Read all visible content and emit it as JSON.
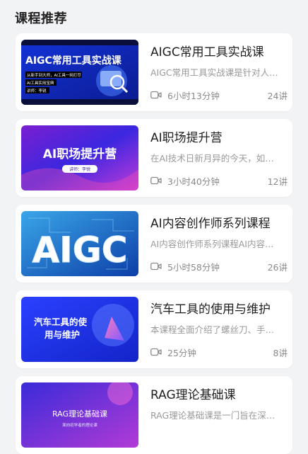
{
  "section": {
    "title": "课程推荐"
  },
  "courses": [
    {
      "title": "AIGC常用工具实战课",
      "description": "AIGC常用工具实战课是针对人…",
      "duration": "6小时13分钟",
      "lessons": "24讲",
      "thumb_title": "AIGC常用工具实战课",
      "thumb_lines": [
        "从新手到大师，AI工具一网打尽",
        "AI工具实用宝典",
        "讲师：李锐"
      ]
    },
    {
      "title": "AI职场提升营",
      "description": "在AI技术日新月异的今天，如…",
      "duration": "3小时40分钟",
      "lessons": "12讲",
      "thumb_title": "AI职场提升营",
      "thumb_lines": [
        "讲师：李锐"
      ]
    },
    {
      "title": "AI内容创作师系列课程",
      "description": "AI内容创作师系列课程AI内容…",
      "duration": "5小时58分钟",
      "lessons": "26讲",
      "thumb_title": "AIGC",
      "thumb_lines": []
    },
    {
      "title": "汽车工具的使用与维护",
      "description": "本课程全面介绍了螺丝刀、手…",
      "duration": "25分钟",
      "lessons": "8讲",
      "thumb_title": "汽车工具的使",
      "thumb_lines": [
        "用与维护"
      ]
    },
    {
      "title": "RAG理论基础课",
      "description": "RAG理论基础课是一门旨在深…",
      "duration": "",
      "lessons": "",
      "thumb_title": "RAG理论基础课",
      "thumb_lines": [
        "面向初学者的理论课"
      ]
    }
  ],
  "icons": {
    "meta": "video-camera-icon"
  },
  "colors": {
    "accent_blue": "#1f35e6",
    "text_primary": "#1f1f1f",
    "text_secondary": "#9a9a9a"
  }
}
